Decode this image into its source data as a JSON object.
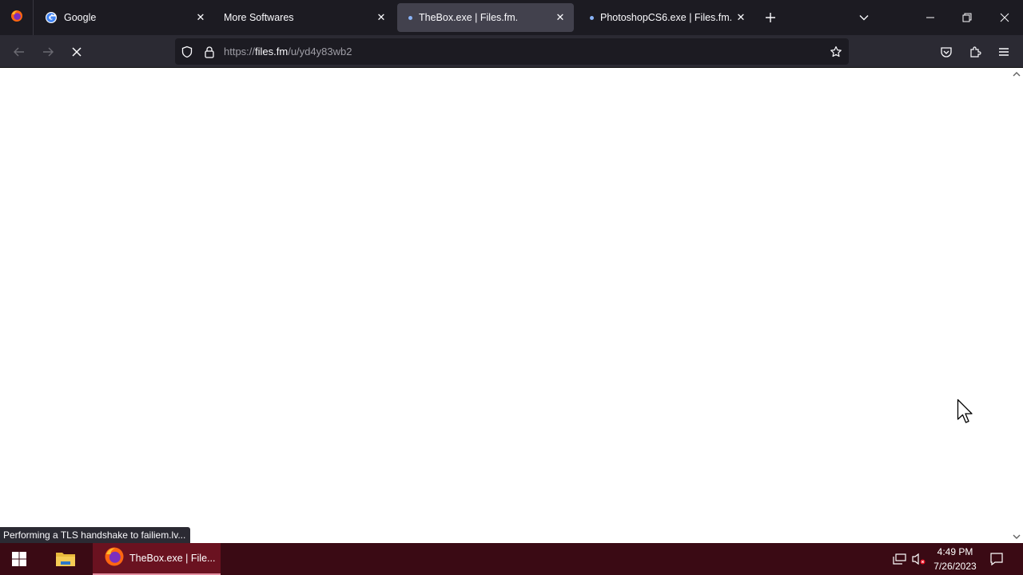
{
  "browser": {
    "tabs": [
      {
        "title": "Google",
        "favicon": "google-icon",
        "active": false
      },
      {
        "title": "More Softwares",
        "favicon": "",
        "active": false
      },
      {
        "title": "TheBox.exe | Files.fm.",
        "favicon": "loading-dot-icon",
        "active": true
      },
      {
        "title": "PhotoshopCS6.exe | Files.fm.",
        "favicon": "loading-dot-icon",
        "active": false
      }
    ],
    "url": {
      "scheme": "https://",
      "host": "files.fm",
      "path": "/u/yd4y83wb2"
    },
    "status_text": "Performing a TLS handshake to failiem.lv...",
    "accent_color": "#42414d"
  },
  "taskbar": {
    "active_app_label": "TheBox.exe | File...",
    "time": "4:49 PM",
    "date": "7/26/2023",
    "background_color": "#3a0a14"
  }
}
